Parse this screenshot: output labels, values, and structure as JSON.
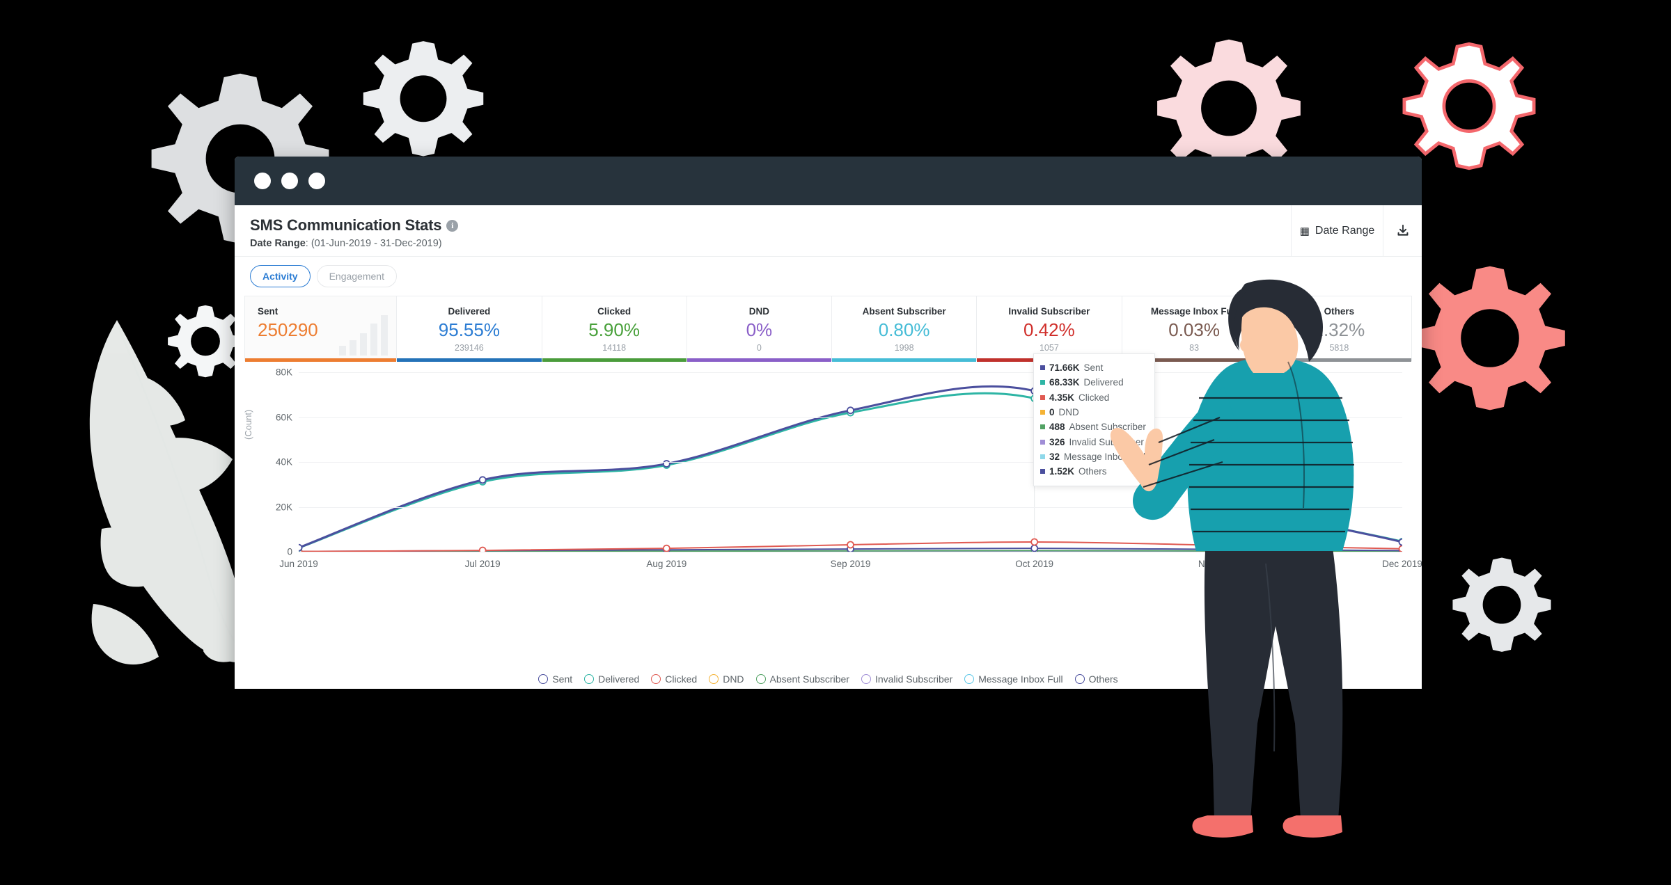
{
  "window": {
    "dots": [
      "close-dot",
      "minimize-dot",
      "maximize-dot"
    ]
  },
  "header": {
    "title": "SMS Communication Stats",
    "info_icon": "i",
    "date_label": "Date Range",
    "date_value": "(01-Jun-2019 - 31-Dec-2019)",
    "date_range_button": "Date Range",
    "calendar_icon": "▦",
    "download_icon": "⤓"
  },
  "tabs": [
    {
      "label": "Activity",
      "active": true
    },
    {
      "label": "Engagement",
      "active": false
    }
  ],
  "stats": [
    {
      "label": "Sent",
      "value": "250290",
      "sub": "",
      "color": "#ed7d31",
      "rule": "#ed7d31",
      "spark": true
    },
    {
      "label": "Delivered",
      "value": "95.55%",
      "sub": "239146",
      "color": "#2b7cd3",
      "rule": "#2472b8"
    },
    {
      "label": "Clicked",
      "value": "5.90%",
      "sub": "14118",
      "color": "#48a03a",
      "rule": "#4a9c3b"
    },
    {
      "label": "DND",
      "value": "0%",
      "sub": "0",
      "color": "#8a5fc8",
      "rule": "#8a5fc8"
    },
    {
      "label": "Absent Subscriber",
      "value": "0.80%",
      "sub": "1998",
      "color": "#45bcd6",
      "rule": "#45bcd6"
    },
    {
      "label": "Invalid Subscriber",
      "value": "0.42%",
      "sub": "1057",
      "color": "#d02f2b",
      "rule": "#c0312c"
    },
    {
      "label": "Message Inbox Full",
      "value": "0.03%",
      "sub": "83",
      "color": "#7a5a50",
      "rule": "#7a5a50"
    },
    {
      "label": "Others",
      "value": "2.32%",
      "sub": "5818",
      "color": "#8e9296",
      "rule": "#8e9296"
    }
  ],
  "tooltip": {
    "rows": [
      {
        "value": "71.66K",
        "name": "Sent",
        "color": "#4b4f9e"
      },
      {
        "value": "68.33K",
        "name": "Delivered",
        "color": "#2eb5a5"
      },
      {
        "value": "4.35K",
        "name": "Clicked",
        "color": "#e05a52"
      },
      {
        "value": "0",
        "name": "DND",
        "color": "#f5b335"
      },
      {
        "value": "488",
        "name": "Absent Subscriber",
        "color": "#52a264"
      },
      {
        "value": "326",
        "name": "Invalid Subscriber",
        "color": "#a08ed6"
      },
      {
        "value": "32",
        "name": "Message Inbox Full",
        "color": "#8fd8ea"
      },
      {
        "value": "1.52K",
        "name": "Others",
        "color": "#4b4f9e"
      }
    ]
  },
  "legend": [
    {
      "label": "Sent",
      "color": "#4b4f9e"
    },
    {
      "label": "Delivered",
      "color": "#2eb5a5"
    },
    {
      "label": "Clicked",
      "color": "#e05a52"
    },
    {
      "label": "DND",
      "color": "#f5b335"
    },
    {
      "label": "Absent Subscriber",
      "color": "#52a264"
    },
    {
      "label": "Invalid Subscriber",
      "color": "#a08ed6"
    },
    {
      "label": "Message Inbox Full",
      "color": "#5cc8e8"
    },
    {
      "label": "Others",
      "color": "#4b4f9e"
    }
  ],
  "chart_data": {
    "type": "line",
    "title": "SMS Communication Stats",
    "xlabel": "",
    "ylabel": "(Count)",
    "ylim": [
      0,
      80000
    ],
    "yticks": [
      0,
      20000,
      40000,
      60000,
      80000
    ],
    "ytick_labels": [
      "0",
      "20K",
      "40K",
      "60K",
      "80K"
    ],
    "grid": true,
    "legend_position": "bottom",
    "categories": [
      "Jun 2019",
      "Jul 2019",
      "Aug 2019",
      "Sep 2019",
      "Oct 2019",
      "Nov 2019",
      "Dec 2019"
    ],
    "series": [
      {
        "name": "Sent",
        "color": "#4b4f9e",
        "values": [
          1800,
          32000,
          39200,
          63000,
          71660,
          25800,
          4300
        ]
      },
      {
        "name": "Delivered",
        "color": "#2eb5a5",
        "values": [
          1700,
          31200,
          38600,
          62000,
          68330,
          25200,
          4500
        ]
      },
      {
        "name": "Clicked",
        "color": "#e05a52",
        "values": [
          100,
          600,
          1500,
          3100,
          4350,
          2900,
          1300
        ]
      },
      {
        "name": "DND",
        "color": "#f5b335",
        "values": [
          0,
          0,
          0,
          0,
          0,
          0,
          0
        ]
      },
      {
        "name": "Absent Subscriber",
        "color": "#52a264",
        "values": [
          40,
          150,
          260,
          380,
          488,
          350,
          180
        ]
      },
      {
        "name": "Invalid Subscriber",
        "color": "#a08ed6",
        "values": [
          25,
          100,
          180,
          250,
          326,
          230,
          120
        ]
      },
      {
        "name": "Message Inbox Full",
        "color": "#5cc8e8",
        "values": [
          3,
          10,
          18,
          26,
          32,
          22,
          10
        ]
      },
      {
        "name": "Others",
        "color": "#4b4f9e",
        "values": [
          120,
          500,
          850,
          1200,
          1520,
          1050,
          520
        ]
      }
    ]
  }
}
